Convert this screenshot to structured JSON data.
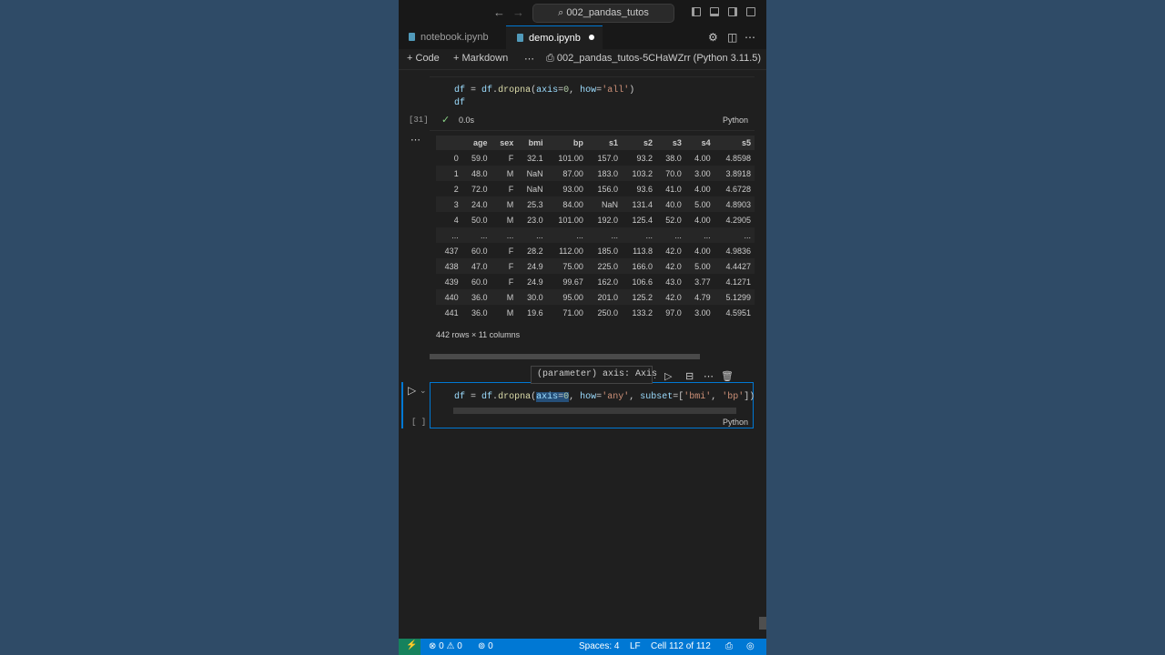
{
  "titlebar": {
    "back_icon": "arrow-left",
    "forward_icon": "arrow-right",
    "search_text": "002_pandas_tutos"
  },
  "tabs": [
    {
      "label": "notebook.ipynb",
      "active": false
    },
    {
      "label": "demo.ipynb",
      "active": true,
      "dirty": true
    }
  ],
  "toolbar": {
    "code_label": "Code",
    "markdown_label": "Markdown",
    "more_label": "⋯",
    "kernel_label": "002_pandas_tutos-5CHaWZrr (Python 3.11.5)"
  },
  "cell1": {
    "line1_var": "df",
    "line1_eq": " = ",
    "line1_obj": "df",
    "line1_dot": ".",
    "line1_fn": "dropna",
    "line1_open": "(",
    "line1_kw1": "axis",
    "line1_eq1": "=",
    "line1_num": "0",
    "line1_sep": ", ",
    "line1_kw2": "how",
    "line1_eq2": "=",
    "line1_str": "'all'",
    "line1_close": ")",
    "line2": "df",
    "exec_count": "[31]",
    "check": "✓",
    "duration": "0.0s",
    "language": "Python"
  },
  "output": {
    "ellipsis": "⋯",
    "columns": [
      "",
      "age",
      "sex",
      "bmi",
      "bp",
      "s1",
      "s2",
      "s3",
      "s4",
      "s5"
    ],
    "rows": [
      [
        "0",
        "59.0",
        "F",
        "32.1",
        "101.00",
        "157.0",
        "93.2",
        "38.0",
        "4.00",
        "4.8598"
      ],
      [
        "1",
        "48.0",
        "M",
        "NaN",
        "87.00",
        "183.0",
        "103.2",
        "70.0",
        "3.00",
        "3.8918"
      ],
      [
        "2",
        "72.0",
        "F",
        "NaN",
        "93.00",
        "156.0",
        "93.6",
        "41.0",
        "4.00",
        "4.6728"
      ],
      [
        "3",
        "24.0",
        "M",
        "25.3",
        "84.00",
        "NaN",
        "131.4",
        "40.0",
        "5.00",
        "4.8903"
      ],
      [
        "4",
        "50.0",
        "M",
        "23.0",
        "101.00",
        "192.0",
        "125.4",
        "52.0",
        "4.00",
        "4.2905"
      ],
      [
        "...",
        "...",
        "...",
        "...",
        "...",
        "...",
        "...",
        "...",
        "...",
        "..."
      ],
      [
        "437",
        "60.0",
        "F",
        "28.2",
        "112.00",
        "185.0",
        "113.8",
        "42.0",
        "4.00",
        "4.9836"
      ],
      [
        "438",
        "47.0",
        "F",
        "24.9",
        "75.00",
        "225.0",
        "166.0",
        "42.0",
        "5.00",
        "4.4427"
      ],
      [
        "439",
        "60.0",
        "F",
        "24.9",
        "99.67",
        "162.0",
        "106.6",
        "43.0",
        "3.77",
        "4.1271"
      ],
      [
        "440",
        "36.0",
        "M",
        "30.0",
        "95.00",
        "201.0",
        "125.2",
        "42.0",
        "4.79",
        "5.1299"
      ],
      [
        "441",
        "36.0",
        "M",
        "19.6",
        "71.00",
        "250.0",
        "133.2",
        "97.0",
        "3.00",
        "4.5951"
      ]
    ],
    "shape": "442 rows × 11 columns"
  },
  "cell2": {
    "tooltip": "(parameter) axis: Axis",
    "code_var": "df",
    "code_eq": " = ",
    "code_obj": "df",
    "code_dot": ".",
    "code_fn": "dropna",
    "code_open": "(",
    "code_kw1": "axis",
    "code_eq1": "=",
    "code_num": "0",
    "code_sep1": ", ",
    "code_kw2": "how",
    "code_eq2": "=",
    "code_str1": "'any'",
    "code_sep2": ", ",
    "code_kw3": "subset",
    "code_eq3": "=[",
    "code_str2": "'bmi'",
    "code_sep3": ", ",
    "code_str3": "'bp'",
    "code_close": "])",
    "exec_count": "[ ]",
    "language": "Python",
    "more": "⋯"
  },
  "statusbar": {
    "errors": "0",
    "warnings": "0",
    "ports": "0",
    "spaces": "Spaces: 4",
    "eol": "LF",
    "cell_pos": "Cell 112 of 112"
  },
  "colors": {
    "accent": "#0078d4",
    "editor_bg": "#1f1f1f",
    "page_bg": "#2e4a66"
  }
}
